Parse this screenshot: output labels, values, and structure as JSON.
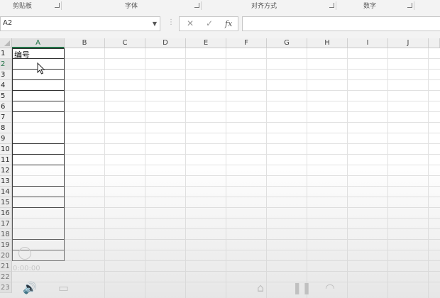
{
  "ribbon": {
    "groups": [
      {
        "label": "剪贴板"
      },
      {
        "label": "字体"
      },
      {
        "label": "对齐方式"
      },
      {
        "label": "数字"
      }
    ]
  },
  "formula_bar": {
    "name_box": "A2",
    "formula": ""
  },
  "sheet": {
    "columns": [
      "A",
      "B",
      "C",
      "D",
      "E",
      "F",
      "G",
      "H",
      "I",
      "J"
    ],
    "rows": [
      "1",
      "2",
      "3",
      "4",
      "5",
      "6",
      "7",
      "8",
      "9",
      "10",
      "11",
      "12",
      "13",
      "14",
      "15",
      "16",
      "17",
      "18",
      "19",
      "20",
      "21",
      "22",
      "23"
    ],
    "cells": {
      "A1": "编号"
    },
    "selected_cell": "A2"
  },
  "video": {
    "time": "0:00:00"
  },
  "icons": [
    "cancel-icon",
    "enter-icon",
    "fx-icon",
    "mouse-pointer-icon",
    "volume-icon",
    "dropdown-arrow-icon"
  ]
}
